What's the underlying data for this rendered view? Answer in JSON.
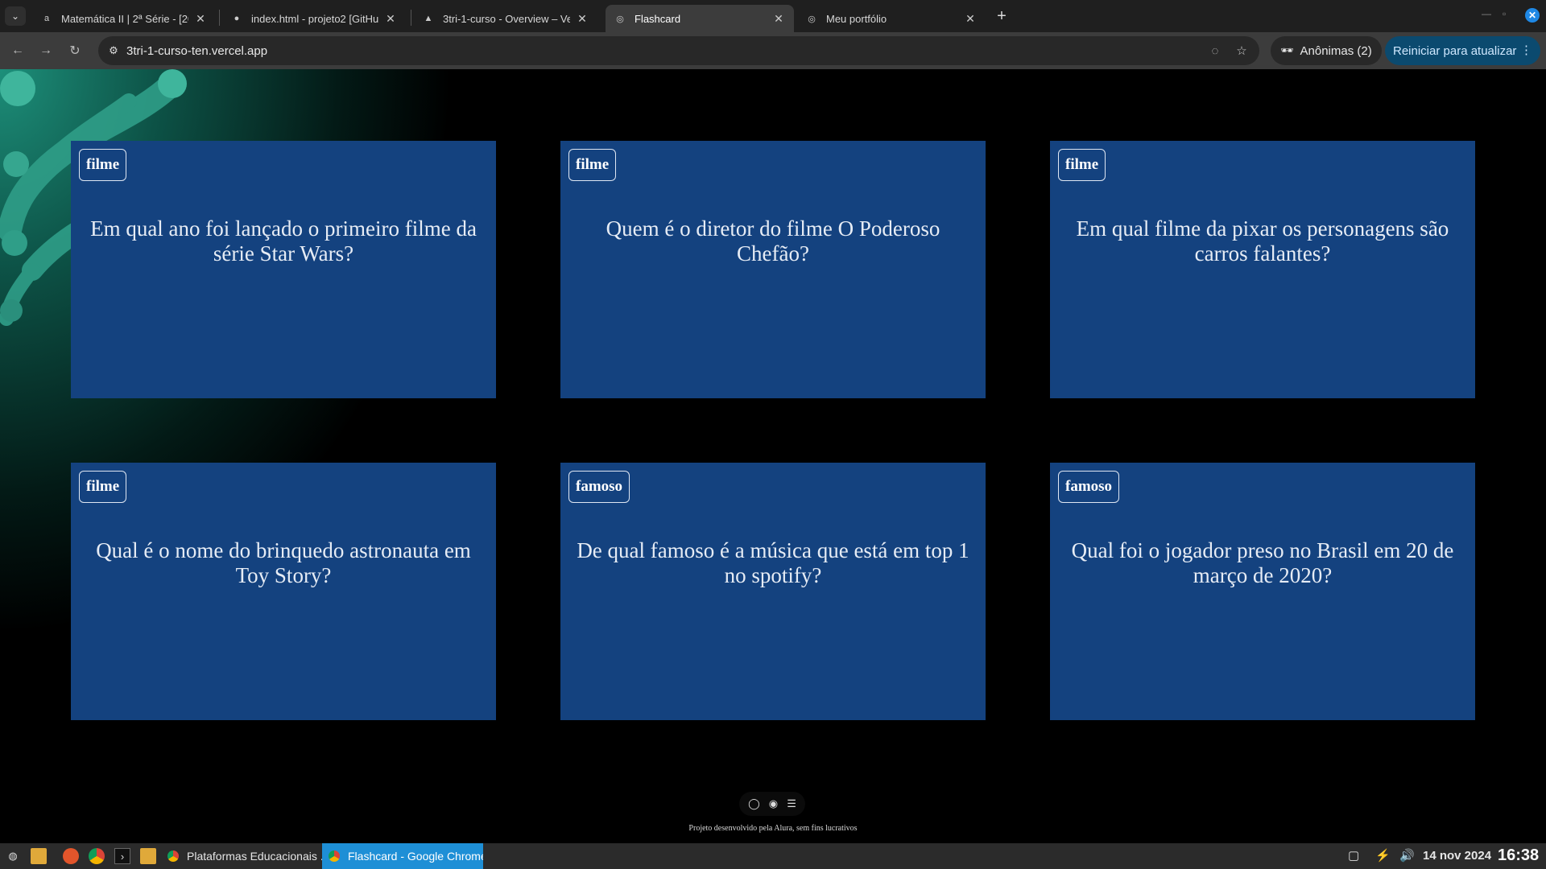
{
  "browser": {
    "tabs": [
      {
        "title": "Matemática II | 2ª Série - [20",
        "favicon": "a-logo-icon",
        "active": false
      },
      {
        "title": "index.html - projeto2 [GitHub",
        "favicon": "github-icon",
        "active": false
      },
      {
        "title": "3tri-1-curso - Overview – Ve",
        "favicon": "vercel-triangle-icon",
        "active": false
      },
      {
        "title": "Flashcard",
        "favicon": "globe-icon",
        "active": true
      },
      {
        "title": "Meu portfólio",
        "favicon": "globe-icon",
        "active": false
      }
    ],
    "url": "3tri-1-curso-ten.vercel.app",
    "incognito_label": "Anônimas (2)",
    "update_label": "Reiniciar para atualizar"
  },
  "cards": [
    {
      "tag": "filme",
      "question": "Em qual ano foi lançado o primeiro filme da série Star Wars?"
    },
    {
      "tag": "filme",
      "question": "Quem é o diretor do filme O Poderoso Chefão?"
    },
    {
      "tag": "filme",
      "question": "Em qual filme da pixar os personagens são carros falantes?"
    },
    {
      "tag": "filme",
      "question": "Qual é o nome do brinquedo astronauta em Toy Story?"
    },
    {
      "tag": "famoso",
      "question": "De qual famoso é a música que está em top 1 no spotify?"
    },
    {
      "tag": "famoso",
      "question": "Qual foi o jogador preso no Brasil em 20 de março de 2020?"
    }
  ],
  "footer": {
    "text": "Projeto desenvolvido pela Alura, sem fins lucrativos"
  },
  "taskbar": {
    "windows": [
      {
        "title": "Plataformas Educacionais ...",
        "active": false
      },
      {
        "title": "Flashcard - Google Chrome",
        "active": true
      }
    ],
    "date": "14 nov 2024",
    "time": "16:38"
  },
  "colors": {
    "card": "#14427f",
    "page_bg": "#000000",
    "teal_accent": "#3fb59c",
    "taskbar_active": "#1e8fd6"
  }
}
